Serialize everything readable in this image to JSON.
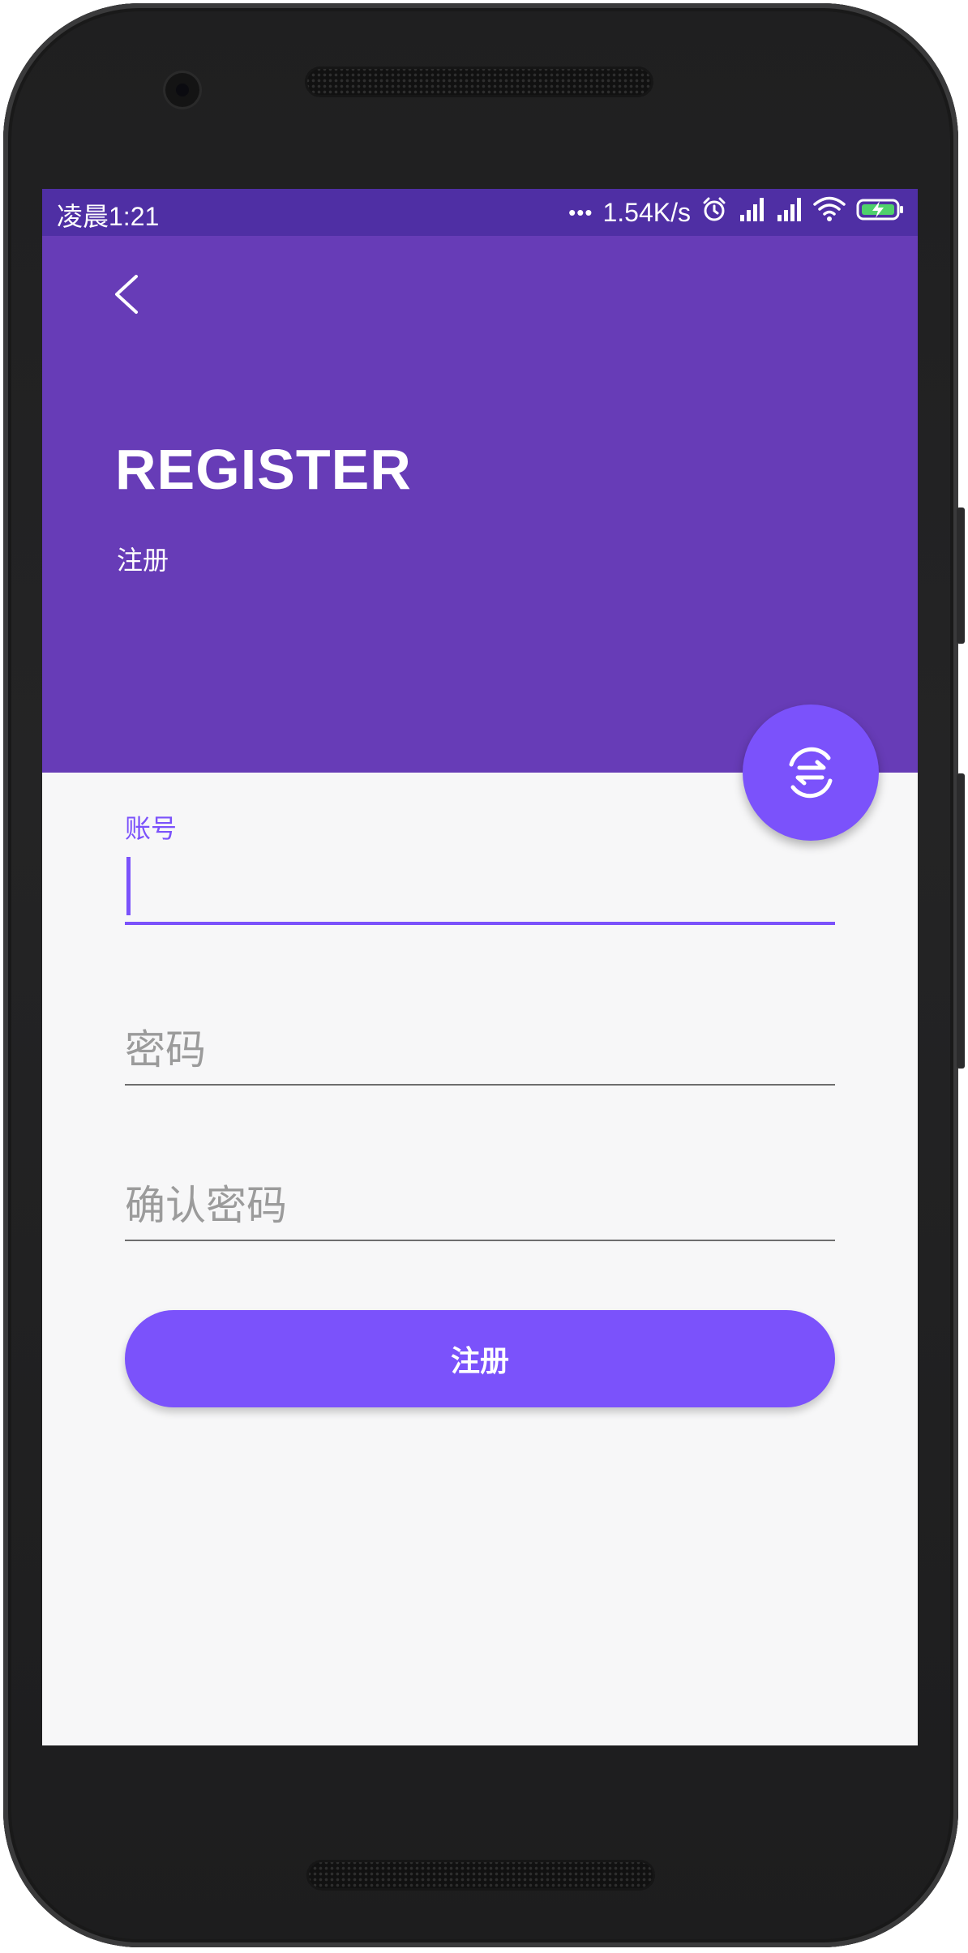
{
  "status_bar": {
    "time": "凌晨1:21",
    "dots": "•••",
    "network_speed": "1.54K/s",
    "icons": [
      "alarm-icon",
      "signal-icon",
      "signal-icon",
      "wifi-icon",
      "battery-charging-icon"
    ]
  },
  "header": {
    "title": "REGISTER",
    "subtitle": "注册",
    "back_icon": "chevron-left-icon"
  },
  "fab": {
    "icon": "swap-refresh-icon"
  },
  "form": {
    "account_label": "账号",
    "account_value": "",
    "password_placeholder": "密码",
    "confirm_placeholder": "确认密码",
    "submit_label": "注册"
  },
  "colors": {
    "header": "#673cb7",
    "status_bar": "#4f2fa4",
    "accent": "#7b52fb",
    "background": "#f7f7f8"
  }
}
